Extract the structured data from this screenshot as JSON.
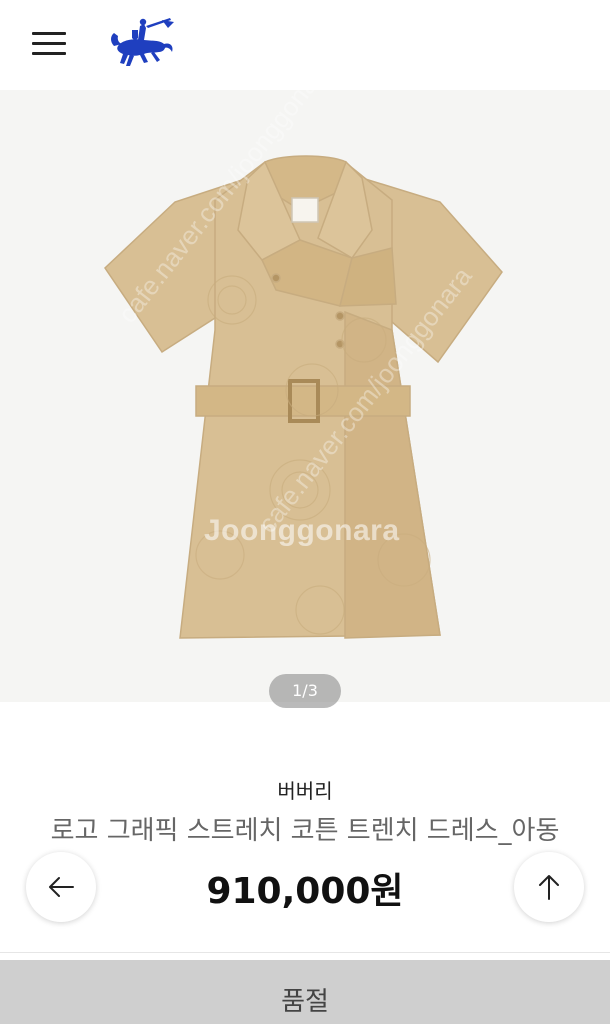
{
  "header": {
    "menu_icon": "hamburger-menu-icon",
    "logo_icon": "equestrian-knight-logo-icon",
    "logo_color": "#1f3fbf"
  },
  "gallery": {
    "watermark": "Joonggonara",
    "watermark_diag_1": "cafe.naver.com/joonggonara",
    "watermark_diag_2": "cafe.naver.com/joonggonara",
    "pager": "1/3",
    "background": "#f5f5f3",
    "dress_color": "#d8bf94"
  },
  "product": {
    "brand": "버버리",
    "name": "로고 그래픽 스트레치 코튼 트렌치 드레스_아동",
    "price": "910,000원"
  },
  "actions": {
    "back_icon": "arrow-left-icon",
    "top_icon": "arrow-up-icon",
    "soldout_label": "품절"
  }
}
